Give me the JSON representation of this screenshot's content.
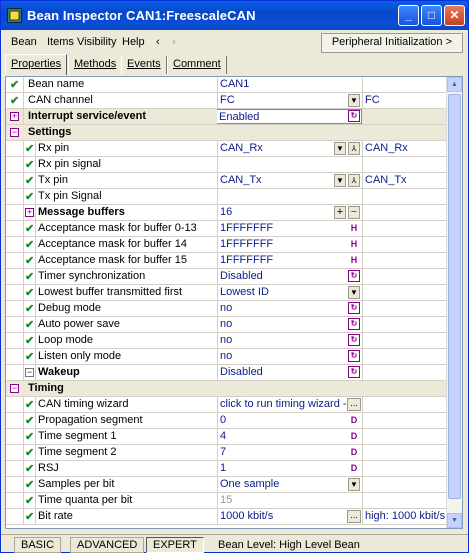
{
  "title": "Bean Inspector CAN1:FreescaleCAN",
  "titlebar_buttons": {
    "minimize": "_",
    "maximize": "□",
    "close": "✕"
  },
  "menu": {
    "bean": "Bean",
    "items_visibility": "Items Visibility",
    "help": "Help",
    "back": "‹",
    "forward": "›",
    "peripheral": "Peripheral Initialization >"
  },
  "tabs": [
    "Properties",
    "Methods",
    "Events",
    "Comment"
  ],
  "rows": [
    {
      "name": "Bean name",
      "value": "CAN1"
    },
    {
      "name": "CAN channel",
      "value": "FC",
      "extra": "FC"
    },
    {
      "name": "Interrupt service/event",
      "value": "Enabled"
    },
    {
      "name": "Settings"
    },
    {
      "name": "Rx pin",
      "value": "CAN_Rx",
      "extra": "CAN_Rx"
    },
    {
      "name": "Rx pin signal",
      "value": ""
    },
    {
      "name": "Tx pin",
      "value": "CAN_Tx",
      "extra": "CAN_Tx"
    },
    {
      "name": "Tx pin Signal",
      "value": ""
    },
    {
      "name": "Message buffers",
      "value": "16"
    },
    {
      "name": "Acceptance mask for buffer 0-13",
      "value": "1FFFFFFF"
    },
    {
      "name": "Acceptance mask for buffer 14",
      "value": "1FFFFFFF"
    },
    {
      "name": "Acceptance mask for buffer 15",
      "value": "1FFFFFFF"
    },
    {
      "name": "Timer synchronization",
      "value": "Disabled"
    },
    {
      "name": "Lowest buffer transmitted first",
      "value": "Lowest ID"
    },
    {
      "name": "Debug mode",
      "value": "no"
    },
    {
      "name": "Auto power save",
      "value": "no"
    },
    {
      "name": "Loop mode",
      "value": "no"
    },
    {
      "name": "Listen only mode",
      "value": "no"
    },
    {
      "name": "Wakeup",
      "value": "Disabled"
    },
    {
      "name": "Timing"
    },
    {
      "name": "CAN timing wizard",
      "value": "click to run timing wizard ->"
    },
    {
      "name": "Propagation segment",
      "value": "0"
    },
    {
      "name": "Time segment 1",
      "value": "4"
    },
    {
      "name": "Time segment 2",
      "value": "7"
    },
    {
      "name": "RSJ",
      "value": "1"
    },
    {
      "name": "Samples per bit",
      "value": "One sample"
    },
    {
      "name": "Time quanta per bit",
      "value": "15"
    },
    {
      "name": "Bit rate",
      "value": "1000 kbit/s",
      "extra": "high: 1000 kbit/s"
    }
  ],
  "status": {
    "basic": "BASIC",
    "advanced": "ADVANCED",
    "expert": "EXPERT",
    "level": "Bean Level: High Level Bean"
  }
}
